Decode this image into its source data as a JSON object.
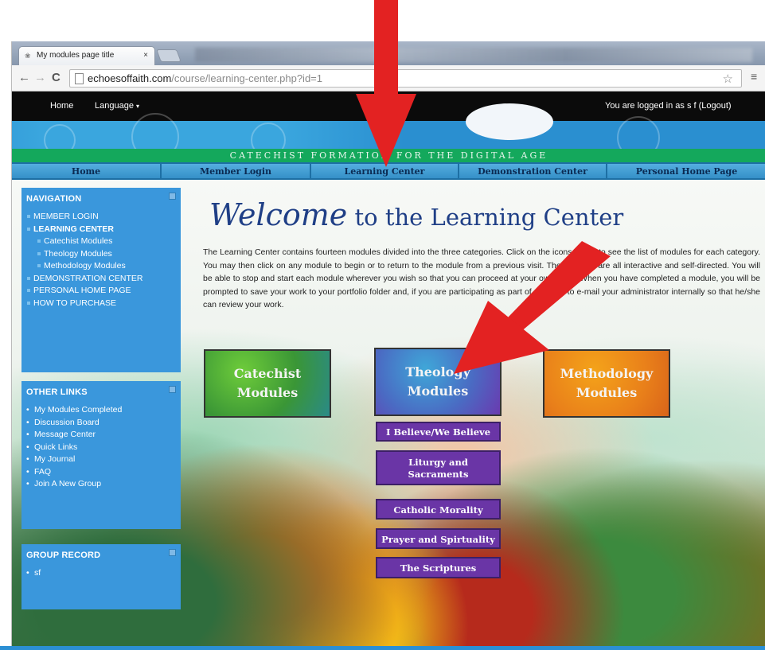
{
  "browser": {
    "tab_title": "My modules page title",
    "tab_close": "×",
    "url_domain": "echoesoffaith.com",
    "url_path": "/course/learning-center.php?id=1"
  },
  "topbar": {
    "home": "Home",
    "language": "Language",
    "login_status": "You are logged in as s f (Logout)"
  },
  "tagline": "CATECHIST FORMATION FOR THE DIGITAL AGE",
  "main_nav": [
    "Home",
    "Member Login",
    "Learning Center",
    "Demonstration Center",
    "Personal Home Page"
  ],
  "sidebar": {
    "navigation": {
      "title": "NAVIGATION",
      "items": [
        "MEMBER LOGIN",
        "LEARNING CENTER",
        "Catechist Modules",
        "Theology Modules",
        "Methodology Modules",
        "DEMONSTRATION CENTER",
        "PERSONAL HOME PAGE",
        "HOW TO PURCHASE"
      ]
    },
    "other_links": {
      "title": "OTHER LINKS",
      "items": [
        "My Modules Completed",
        "Discussion Board",
        "Message Center",
        "Quick Links",
        "My Journal",
        "FAQ",
        "Join A New Group"
      ]
    },
    "group_record": {
      "title": "GROUP RECORD",
      "items": [
        "sf"
      ]
    }
  },
  "main": {
    "welcome_script": "Welcome",
    "welcome_rest": " to the Learning Center",
    "intro": "The Learning Center contains fourteen modules divided into the three categories. Click on the icons below to see the list of modules for each category. You may then click on any module to begin or to return to the module from a previous visit.  The modules are all interactive and self-directed. You will be able to stop and start each module wherever you wish so that you can proceed at your own pace. When you have completed a module, you will be prompted to save your work to your portfolio folder and, if you are participating as part of a group, to e-mail your administrator internally so that he/she can review your work.",
    "categories": [
      {
        "line1": "Catechist",
        "line2": "Modules"
      },
      {
        "line1": "Theology",
        "line2": "Modules"
      },
      {
        "line1": "Methodology",
        "line2": "Modules"
      }
    ],
    "theology_modules": [
      "I Believe/We Believe",
      "Liturgy and Sacraments",
      "Catholic Morality",
      "Prayer and Spirtuality",
      "The Scriptures"
    ]
  },
  "colors": {
    "arrow": "#e32222",
    "sidebar_blue": "#3a97dc",
    "purple_button": "#6a35a6",
    "tagline_green": "#14a85c"
  }
}
